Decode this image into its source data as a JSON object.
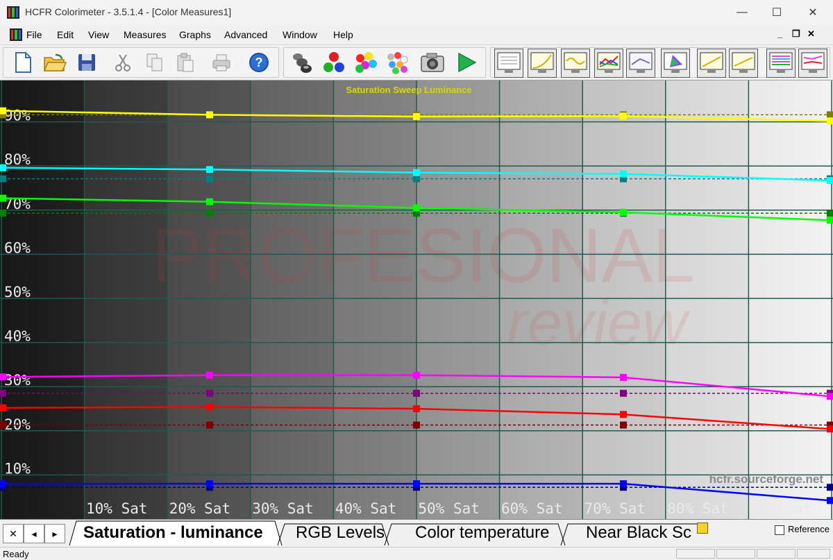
{
  "window": {
    "title": "HCFR Colorimeter - 3.5.1.4 - [Color Measures1]",
    "minimize_glyph": "—",
    "maximize_glyph": "☐",
    "close_glyph": "✕"
  },
  "menu": {
    "items": [
      "File",
      "Edit",
      "View",
      "Measures",
      "Graphs",
      "Advanced",
      "Window",
      "Help"
    ],
    "mdi_minimize": "_",
    "mdi_restore": "❐",
    "mdi_close": "✕"
  },
  "toolbar": {
    "file_buttons": [
      "new-document-icon",
      "open-folder-icon",
      "save-disk-icon"
    ],
    "edit_buttons": [
      "cut-icon",
      "copy-icon",
      "paste-icon"
    ],
    "print_button": "print-icon",
    "help_button": "help-icon",
    "measure_buttons": [
      "probe-sensor-icon",
      "rgb-dots-icon",
      "colors-icon",
      "palette-icon",
      "camera-icon",
      "play-icon"
    ],
    "graph_buttons": [
      "graph-sheet-icon",
      "graph-gamma-icon",
      "graph-curve-icon",
      "graph-rgb-icon",
      "graph-color-temp-icon",
      "graph-cie-icon",
      "graph-white-icon",
      "graph-luminance-icon",
      "graph-multi-icon",
      "graph-sweep-icon"
    ]
  },
  "chart_data": {
    "type": "line",
    "title": "Saturation Sweep Luminance",
    "watermark": "hcfr.sourceforge.net",
    "background_watermark_top": "PROFESIONAL",
    "background_watermark_bottom": "review",
    "ylim": [
      0,
      100
    ],
    "y_ticks": [
      "10%",
      "20%",
      "30%",
      "40%",
      "50%",
      "60%",
      "70%",
      "80%",
      "90%"
    ],
    "x_ticks": [
      "10% Sat",
      "20% Sat",
      "30% Sat",
      "40% Sat",
      "50% Sat",
      "60% Sat",
      "70% Sat",
      "80% Sat",
      "90% Sat"
    ],
    "x": [
      0,
      25,
      50,
      75,
      100
    ],
    "grid": true,
    "series": [
      {
        "color": "#ffff00",
        "values": [
          92.5,
          91.6,
          91.2,
          91.3,
          90.2
        ]
      },
      {
        "color": "#00ffff",
        "values": [
          79.6,
          79.2,
          78.5,
          78.2,
          76.7
        ]
      },
      {
        "color": "#00ff00",
        "values": [
          72.7,
          71.9,
          70.5,
          69.5,
          67.7
        ]
      },
      {
        "color": "#ff00ff",
        "values": [
          32.2,
          32.6,
          32.6,
          32.1,
          27.8
        ]
      },
      {
        "color": "#ff0000",
        "values": [
          25.2,
          25.4,
          25.0,
          23.7,
          20.4
        ]
      },
      {
        "color": "#0000ff",
        "values": [
          8.0,
          8.0,
          8.0,
          8.0,
          4.2
        ]
      }
    ],
    "reference_series": [
      {
        "color": "#808000",
        "values": [
          91.6,
          91.6,
          91.6,
          91.6,
          91.6
        ]
      },
      {
        "color": "#008080",
        "values": [
          77.1,
          77.1,
          77.1,
          77.1,
          77.1
        ]
      },
      {
        "color": "#008000",
        "values": [
          69.3,
          69.3,
          69.3,
          69.3,
          69.3
        ]
      },
      {
        "color": "#800080",
        "values": [
          28.5,
          28.5,
          28.5,
          28.5,
          28.5
        ]
      },
      {
        "color": "#800000",
        "values": [
          21.3,
          21.3,
          21.3,
          21.3,
          21.3
        ]
      },
      {
        "color": "#000080",
        "values": [
          7.2,
          7.2,
          7.2,
          7.2,
          7.2
        ]
      }
    ]
  },
  "tabs": {
    "nav_first": "✕",
    "nav_prev": "◂",
    "nav_next": "▸",
    "items": [
      "Saturation - luminance",
      "RGB Levels",
      "Color temperature",
      "Near Black Sc"
    ],
    "reference_label": "Reference"
  },
  "status": {
    "text": "Ready"
  }
}
